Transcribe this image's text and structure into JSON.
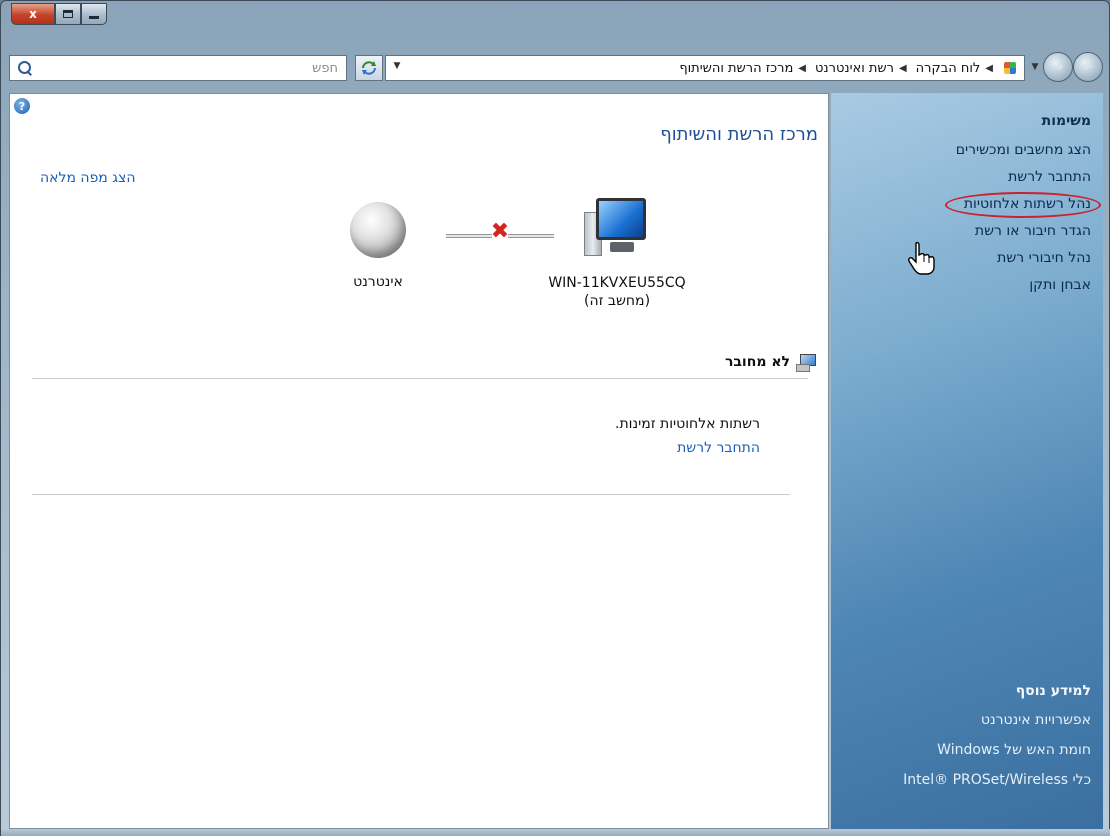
{
  "window": {
    "caption": {
      "close_glyph": "x"
    }
  },
  "toolbar": {
    "search_placeholder": "חפש",
    "breadcrumbs": [
      "לוח הבקרה",
      "רשת ואינטרנט",
      "מרכז הרשת והשיתוף"
    ]
  },
  "main": {
    "help_glyph": "?",
    "title": "מרכז הרשת והשיתוף",
    "full_map_link": "הצג מפה מלאה",
    "map": {
      "internet_label": "אינטרנט",
      "computer_name": "WIN-11KVXEU55CQ",
      "computer_sub": "(מחשב זה)",
      "broken_link_glyph": "✖"
    },
    "status_header": "לא מחובר",
    "no_networks_text": "רשתות אלחוטיות זמינות.",
    "connect_link": "התחבר לרשת"
  },
  "taskpane": {
    "tasks_heading": "משימות",
    "tasks": [
      "הצג מחשבים ומכשירים",
      "התחבר לרשת",
      "נהל רשתות אלחוטיות",
      "הגדר חיבור או רשת",
      "נהל חיבורי רשת",
      "אבחן ותקן"
    ],
    "learn_more_heading": "למידע נוסף",
    "learn_more": [
      "אפשרויות אינטרנט",
      "חומת האש של Windows",
      "כלי Intel® PROSet/Wireless"
    ]
  },
  "colors": {
    "link": "#1a5fb4",
    "title": "#1f4e99",
    "highlight_ring": "#c8242c",
    "error_x": "#d3261e"
  },
  "icons": {
    "nav_back": "arrow-left-icon",
    "nav_forward": "arrow-right-icon",
    "refresh": "refresh-icon",
    "search": "search-icon",
    "help": "help-icon",
    "globe": "globe-icon",
    "computer": "computer-icon",
    "network_status": "network-status-icon",
    "cursor": "hand-cursor-icon"
  }
}
